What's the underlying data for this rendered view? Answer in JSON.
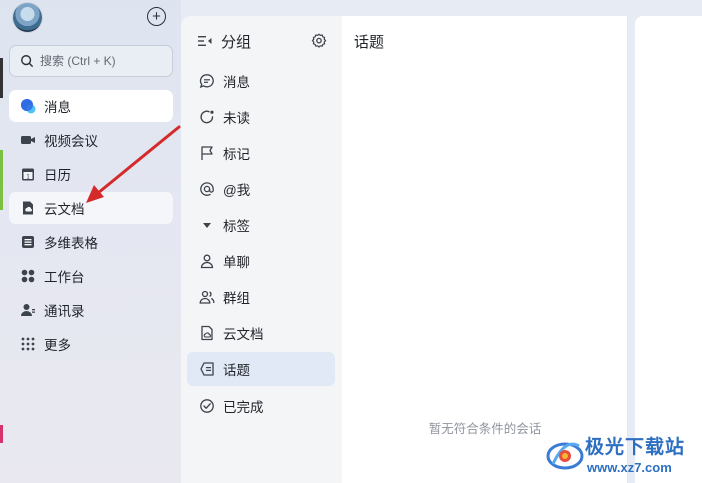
{
  "leftnav": {
    "search_placeholder": "搜索 (Ctrl + K)",
    "items": [
      {
        "label": "消息",
        "icon": "message-bubble-icon"
      },
      {
        "label": "视频会议",
        "icon": "video-camera-icon"
      },
      {
        "label": "日历",
        "icon": "calendar-icon"
      },
      {
        "label": "云文档",
        "icon": "cloud-doc-icon"
      },
      {
        "label": "多维表格",
        "icon": "table-grid-icon"
      },
      {
        "label": "工作台",
        "icon": "apps-icon"
      },
      {
        "label": "通讯录",
        "icon": "contacts-icon"
      },
      {
        "label": "更多",
        "icon": "more-dots-icon"
      }
    ]
  },
  "groups": {
    "title": "分组",
    "items": [
      {
        "label": "消息",
        "icon": "chat-icon"
      },
      {
        "label": "未读",
        "icon": "unread-icon"
      },
      {
        "label": "标记",
        "icon": "flag-icon"
      },
      {
        "label": "@我",
        "icon": "at-icon"
      },
      {
        "label": "标签",
        "icon": "triangle-down-icon"
      },
      {
        "label": "单聊",
        "icon": "person-icon"
      },
      {
        "label": "群组",
        "icon": "group-icon"
      },
      {
        "label": "云文档",
        "icon": "doc-icon"
      },
      {
        "label": "话题",
        "icon": "topic-icon"
      },
      {
        "label": "已完成",
        "icon": "check-circle-icon"
      }
    ]
  },
  "content": {
    "title": "话题",
    "empty_text": "暂无符合条件的会话"
  },
  "watermark": {
    "name": "极光下载站",
    "url": "www.xz7.com"
  },
  "colors": {
    "accent": "#2f6ae0",
    "selected_bg": "#e1e9f6",
    "arrow": "#d42a2a"
  }
}
